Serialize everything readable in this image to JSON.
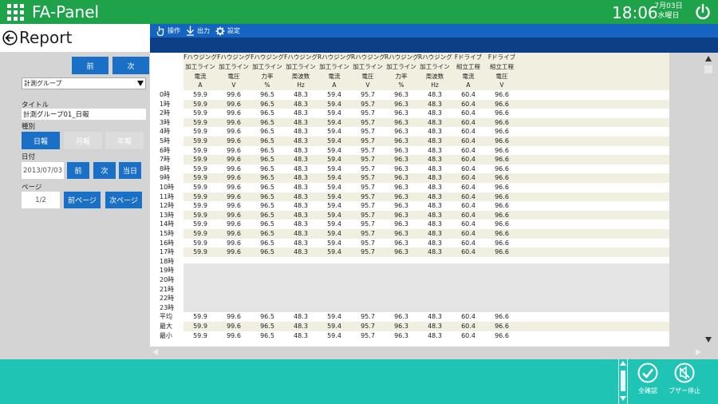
{
  "header": {
    "app_title": "FA-Panel",
    "time": "18:06",
    "date": "7月03日",
    "weekday": "水曜日"
  },
  "page": {
    "title": "Report"
  },
  "left": {
    "prev_label": "前",
    "next_label": "次",
    "group_select": "計測グループ",
    "title_label": "タイトル",
    "title_value": "計測グループ01_日報",
    "kind_label": "種別",
    "kind_daily": "日報",
    "kind_monthly": "月報",
    "kind_yearly": "年報",
    "date_label": "日付",
    "date_value": "2013/07/03",
    "date_prev": "前",
    "date_next": "次",
    "date_today": "当日",
    "page_label": "ページ",
    "page_value": "1/2",
    "page_prev": "前ページ",
    "page_next": "次ページ"
  },
  "toolbar": {
    "operate": "操作",
    "output": "出力",
    "settings": "設定"
  },
  "table": {
    "columns": [
      [
        "Fハウジング",
        "加工ライン",
        "電流",
        "A"
      ],
      [
        "Fハウジング",
        "加工ライン",
        "電圧",
        "V"
      ],
      [
        "Fハウジング",
        "加工ライン",
        "力率",
        "%"
      ],
      [
        "Fハウジング",
        "加工ライン",
        "周波数",
        "Hz"
      ],
      [
        "Rハウジング",
        "加工ライン",
        "電流",
        "A"
      ],
      [
        "Rハウジング",
        "加工ライン",
        "電圧",
        "V"
      ],
      [
        "Rハウジング",
        "加工ライン",
        "力率",
        "%"
      ],
      [
        "Rハウジング",
        "加工ライン",
        "周波数",
        "Hz"
      ],
      [
        "Fドライブ",
        "組立工程",
        "電流",
        "A"
      ],
      [
        "Fドライブ",
        "組立工程",
        "電圧",
        "V"
      ]
    ],
    "rows": [
      {
        "label": "0時",
        "values": [
          "59.9",
          "99.6",
          "96.5",
          "48.3",
          "59.4",
          "95.7",
          "96.3",
          "48.3",
          "60.4",
          "96.6"
        ]
      },
      {
        "label": "1時",
        "values": [
          "59.9",
          "99.6",
          "96.5",
          "48.3",
          "59.4",
          "95.7",
          "96.3",
          "48.3",
          "60.4",
          "96.6"
        ]
      },
      {
        "label": "2時",
        "values": [
          "59.9",
          "99.6",
          "96.5",
          "48.3",
          "59.4",
          "95.7",
          "96.3",
          "48.3",
          "60.4",
          "96.6"
        ]
      },
      {
        "label": "3時",
        "values": [
          "59.9",
          "99.6",
          "96.5",
          "48.3",
          "59.4",
          "95.7",
          "96.3",
          "48.3",
          "60.4",
          "96.6"
        ]
      },
      {
        "label": "4時",
        "values": [
          "59.9",
          "99.6",
          "96.5",
          "48.3",
          "59.4",
          "95.7",
          "96.3",
          "48.3",
          "60.4",
          "96.6"
        ]
      },
      {
        "label": "5時",
        "values": [
          "59.9",
          "99.6",
          "96.5",
          "48.3",
          "59.4",
          "95.7",
          "96.3",
          "48.3",
          "60.4",
          "96.6"
        ]
      },
      {
        "label": "6時",
        "values": [
          "59.9",
          "99.6",
          "96.5",
          "48.3",
          "59.4",
          "95.7",
          "96.3",
          "48.3",
          "60.4",
          "96.6"
        ]
      },
      {
        "label": "7時",
        "values": [
          "59.9",
          "99.6",
          "96.5",
          "48.3",
          "59.4",
          "95.7",
          "96.3",
          "48.3",
          "60.4",
          "96.6"
        ]
      },
      {
        "label": "8時",
        "values": [
          "59.9",
          "99.6",
          "96.5",
          "48.3",
          "59.4",
          "95.7",
          "96.3",
          "48.3",
          "60.4",
          "96.6"
        ]
      },
      {
        "label": "9時",
        "values": [
          "59.9",
          "99.6",
          "96.5",
          "48.3",
          "59.4",
          "95.7",
          "96.3",
          "48.3",
          "60.4",
          "96.6"
        ]
      },
      {
        "label": "10時",
        "values": [
          "59.9",
          "99.6",
          "96.5",
          "48.3",
          "59.4",
          "95.7",
          "96.3",
          "48.3",
          "60.4",
          "96.6"
        ]
      },
      {
        "label": "11時",
        "values": [
          "59.9",
          "99.6",
          "96.5",
          "48.3",
          "59.4",
          "95.7",
          "96.3",
          "48.3",
          "60.4",
          "96.6"
        ]
      },
      {
        "label": "12時",
        "values": [
          "59.9",
          "99.6",
          "96.5",
          "48.3",
          "59.4",
          "95.7",
          "96.3",
          "48.3",
          "60.4",
          "96.6"
        ]
      },
      {
        "label": "13時",
        "values": [
          "59.9",
          "99.6",
          "96.5",
          "48.3",
          "59.4",
          "95.7",
          "96.3",
          "48.3",
          "60.4",
          "96.6"
        ]
      },
      {
        "label": "14時",
        "values": [
          "59.9",
          "99.6",
          "96.5",
          "48.3",
          "59.4",
          "95.7",
          "96.3",
          "48.3",
          "60.4",
          "96.6"
        ]
      },
      {
        "label": "15時",
        "values": [
          "59.9",
          "99.6",
          "96.5",
          "48.3",
          "59.4",
          "95.7",
          "96.3",
          "48.3",
          "60.4",
          "96.6"
        ]
      },
      {
        "label": "16時",
        "values": [
          "59.9",
          "99.6",
          "96.5",
          "48.3",
          "59.4",
          "95.7",
          "96.3",
          "48.3",
          "60.4",
          "96.6"
        ]
      },
      {
        "label": "17時",
        "values": [
          "59.9",
          "99.6",
          "96.5",
          "48.3",
          "59.4",
          "95.7",
          "96.3",
          "48.3",
          "60.4",
          "96.6"
        ]
      },
      {
        "label": "18時",
        "values": []
      },
      {
        "label": "19時",
        "values": []
      },
      {
        "label": "20時",
        "values": []
      },
      {
        "label": "21時",
        "values": []
      },
      {
        "label": "22時",
        "values": []
      },
      {
        "label": "23時",
        "values": []
      },
      {
        "label": "平均",
        "values": [
          "59.9",
          "99.6",
          "96.5",
          "48.3",
          "59.4",
          "95.7",
          "96.3",
          "48.3",
          "60.4",
          "96.6"
        ]
      },
      {
        "label": "最大",
        "values": [
          "59.9",
          "99.6",
          "96.5",
          "48.3",
          "59.4",
          "95.7",
          "96.3",
          "48.3",
          "60.4",
          "96.6"
        ]
      },
      {
        "label": "最小",
        "values": [
          "59.9",
          "99.6",
          "96.5",
          "48.3",
          "59.4",
          "95.7",
          "96.3",
          "48.3",
          "60.4",
          "96.6"
        ]
      }
    ]
  },
  "footer": {
    "confirm_all": "全確認",
    "buzzer_stop": "ブザー停止"
  },
  "icons": {
    "apps": "grid-icon",
    "power": "power-icon",
    "back": "back-arrow-icon",
    "operate": "hand-pointer-icon",
    "output": "download-arrow-icon",
    "settings": "gear-icon",
    "confirm": "check-circle-icon",
    "buzzer": "mute-bell-icon"
  },
  "colors": {
    "header": "#1fa34a",
    "toolbar": "#1565c0",
    "subbar": "#0d3f87",
    "button": "#1a6fc7",
    "footer": "#20c4b4",
    "row_alt": "#f0efe0"
  }
}
